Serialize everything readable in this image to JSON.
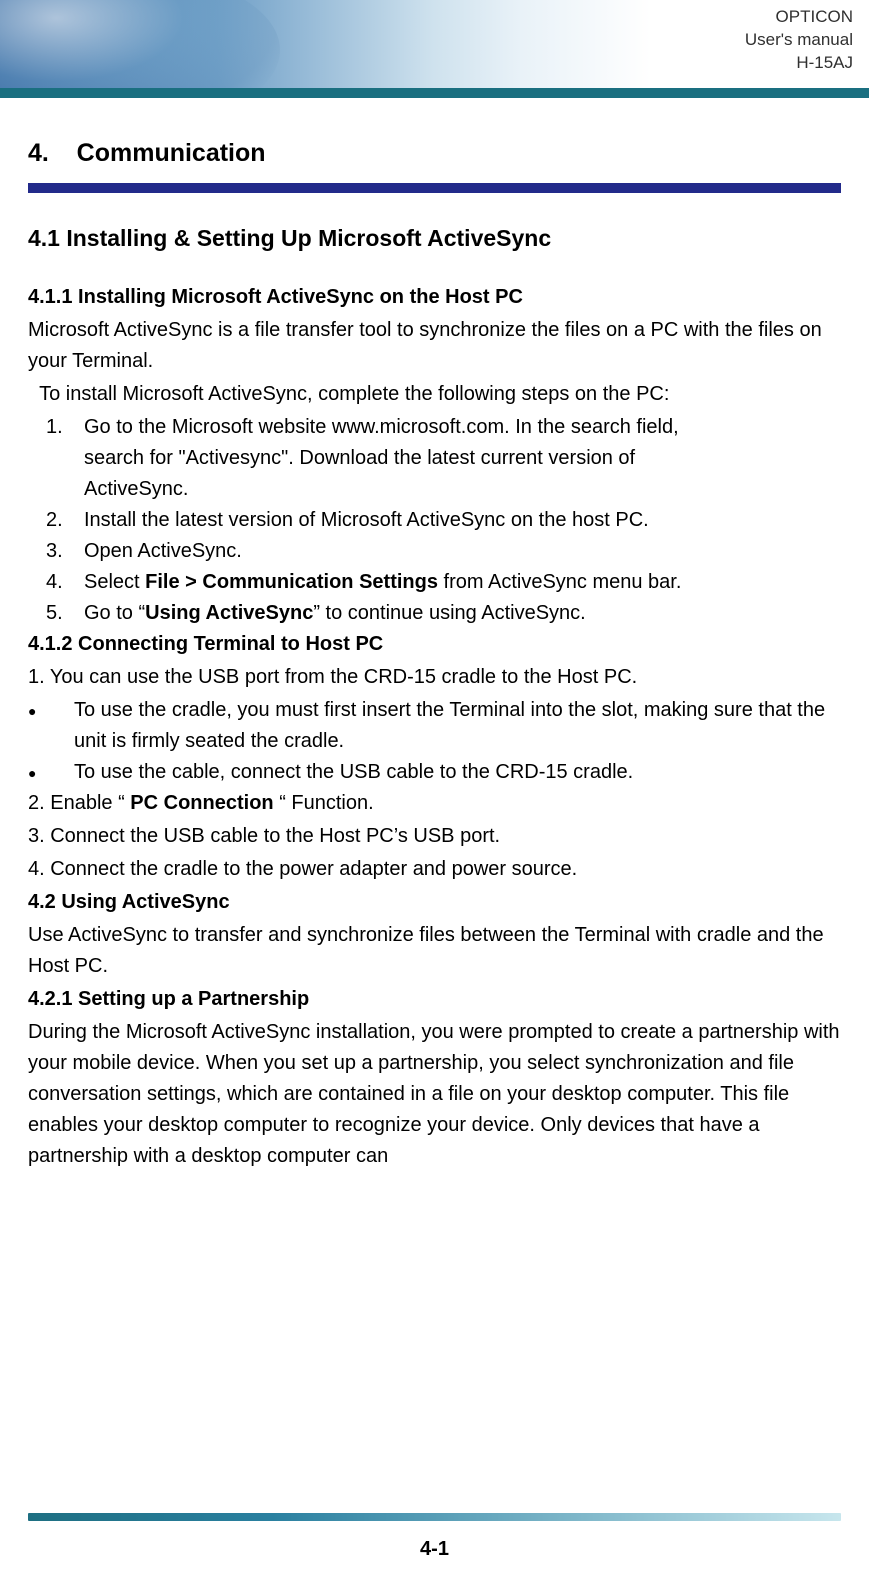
{
  "header": {
    "brand": "OPTICON",
    "line2": "User's manual",
    "model": "H-15AJ"
  },
  "chapter": {
    "number": "4.",
    "title": "Communication"
  },
  "sec41": {
    "heading": "4.1 Installing & Setting Up Microsoft ActiveSync",
    "sub411": {
      "heading": "4.1.1 Installing Microsoft ActiveSync on the Host PC",
      "intro": "Microsoft ActiveSync is a file transfer tool to synchronize the files on a PC with the files on your Terminal.",
      "lead": "  To install Microsoft ActiveSync, complete the following steps on the PC:",
      "steps": {
        "n1_a": "Go to the Microsoft website www.microsoft.com. In the search field,",
        "n1_b": "search for \"Activesync\". Download the latest current version of",
        "n1_c": "ActiveSync.",
        "n2": "Install the latest version of Microsoft ActiveSync on the host PC.",
        "n3": "Open ActiveSync.",
        "n4_pre": "Select ",
        "n4_bold": "File > Communication Settings",
        "n4_post": " from ActiveSync menu bar.",
        "n5_pre": "Go to “",
        "n5_bold": "Using ActiveSync",
        "n5_post": "” to continue using ActiveSync."
      }
    },
    "sub412": {
      "heading": "4.1.2 Connecting Terminal to Host PC",
      "line1": "1. You can use the USB port from the CRD-15 cradle to the Host PC.",
      "b1": "To use the cradle, you must first insert the Terminal into the slot, making sure that the unit is firmly seated the cradle.",
      "b2": "To use the cable, connect the USB cable to the CRD-15 cradle.",
      "line2_pre": "2. Enable “ ",
      "line2_bold": "PC Connection",
      "line2_post": " “ Function.",
      "line3": "3. Connect the USB cable to the Host PC’s USB port.",
      "line4": "4. Connect the cradle to the power adapter and power source."
    }
  },
  "sec42": {
    "heading": "4.2 Using ActiveSync",
    "intro": "Use ActiveSync to transfer and synchronize files between the Terminal with cradle and the Host PC.",
    "sub421": {
      "heading": "4.2.1 Setting up a Partnership",
      "body": "During the Microsoft ActiveSync installation, you were prompted to create a partnership with your mobile device. When you set up a partnership, you select synchronization and file conversation settings, which are contained in a file on your desktop computer. This file enables your desktop computer to recognize your device. Only devices that have a partnership with a desktop computer can"
    }
  },
  "page_number": "4-1",
  "labels": {
    "num1": "1.",
    "num2": "2.",
    "num3": "3.",
    "num4": "4.",
    "num5": "5.",
    "bullet": "●"
  }
}
